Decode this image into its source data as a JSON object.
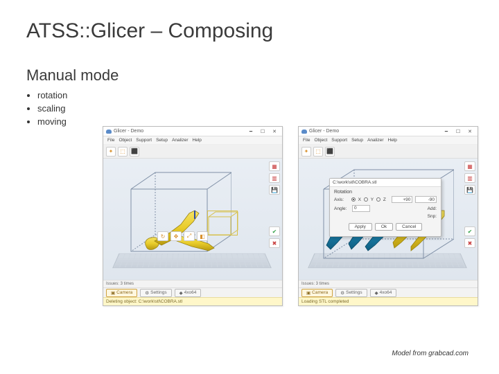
{
  "title": "ATSS::Glicer – Composing",
  "subtitle": "Manual mode",
  "bullets": [
    "rotation",
    "scaling",
    "moving"
  ],
  "footnote": "Model from grabcad.com",
  "app": {
    "title": "Glicer - Demo",
    "menus": [
      "File",
      "Object",
      "Support",
      "Setup",
      "Analizer",
      "Help"
    ],
    "tabs": {
      "camera": "Camera",
      "settings": "Settings",
      "model": "4xo64"
    },
    "status_left": "Deleting object: C:\\work\\stl\\COBRA.stl",
    "status_right": "Loading STL completed",
    "issues": "Issues: 3 times"
  },
  "dialog": {
    "title": "C:\\work\\stl\\COBRA.stl",
    "section": "Rotation",
    "axis_label": "Axis:",
    "axes": [
      "X",
      "Y",
      "Z"
    ],
    "spin1": "+90",
    "spin2": "-90",
    "angle_label": "Angle:",
    "angle_value": "0",
    "add": "Add:",
    "snp": "Snp:",
    "apply": "Apply",
    "ok": "Ok",
    "cancel": "Cancel"
  }
}
